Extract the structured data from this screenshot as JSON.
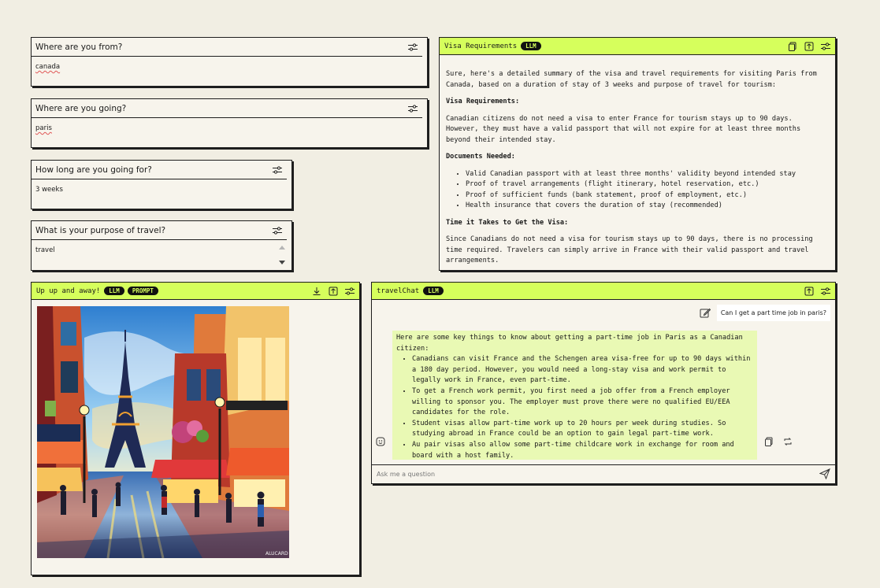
{
  "inputs": [
    {
      "question": "Where are you from?",
      "value": "canada"
    },
    {
      "question": "Where are you going?",
      "value": "paris"
    },
    {
      "question": "How long are you going for?",
      "value": "3 weeks"
    },
    {
      "question": "What is your purpose of travel?",
      "value": "travel"
    }
  ],
  "visa": {
    "title": "Visa Requirements",
    "badge": "LLM",
    "intro": "Sure, here's a detailed summary of the visa and travel requirements for visiting Paris from Canada, based on a duration of stay of 3 weeks and purpose of travel for tourism:",
    "h1": "Visa Requirements:",
    "p1": "Canadian citizens do not need a visa to enter France for tourism stays up to 90 days. However, they must have a valid passport that will not expire for at least three months beyond their intended stay.",
    "h2": "Documents Needed:",
    "docs": [
      "Valid Canadian passport with at least three months' validity beyond intended stay",
      "Proof of travel arrangements (flight itinerary, hotel reservation, etc.)",
      "Proof of sufficient funds (bank statement, proof of employment, etc.)",
      "Health insurance that covers the duration of stay (recommended)"
    ],
    "h3": "Time it Takes to Get the Visa:",
    "p3": "Since Canadians do not need a visa for tourism stays up to 90 days, there is no processing time required. Travelers can simply arrive in France with their valid passport and travel arrangements."
  },
  "image_node": {
    "title": "Up up and away!",
    "badge1": "LLM",
    "badge2": "PROMPT",
    "signature": "ALUCARD"
  },
  "chat": {
    "title": "travelChat",
    "badge": "LLM",
    "user_message": "Can I get a part time job in paris?",
    "response_intro": "Here are some key things to know about getting a part-time job in Paris as a Canadian citizen:",
    "response_points": [
      "Canadians can visit France and the Schengen area visa-free for up to 90 days within a 180 day period. However, you would need a long-stay visa and work permit to legally work in France, even part-time.",
      "To get a French work permit, you first need a job offer from a French employer willing to sponsor you. The employer must prove there were no qualified EU/EEA candidates for the role.",
      "Student visas allow part-time work up to 20 hours per week during studies. So studying abroad in France could be an option to gain legal part-time work.",
      "Au pair visas also allow some part-time childcare work in exchange for room and board with a host family."
    ],
    "input_placeholder": "Ask me a question"
  },
  "colors": {
    "accent": "#d6ff5c",
    "background": "#f1eee3",
    "card": "#f7f4ec",
    "response_bg": "#e9f9b4"
  }
}
